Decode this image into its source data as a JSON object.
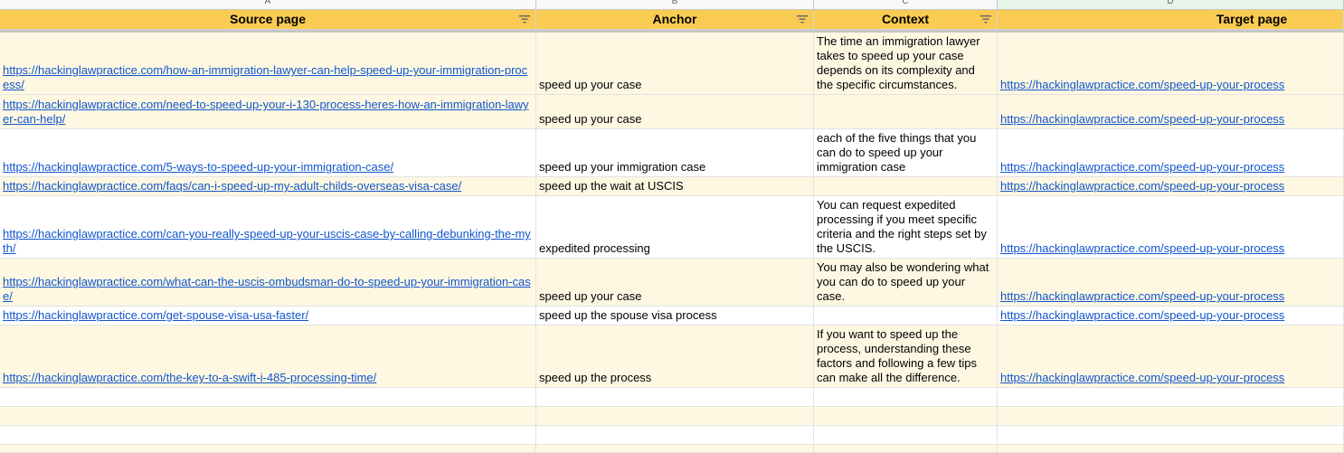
{
  "column_letters": [
    "A",
    "B",
    "C",
    "D"
  ],
  "headers": [
    "Source page",
    "Anchor",
    "Context",
    "Target page"
  ],
  "icons": {
    "filter": "filter-icon"
  },
  "colors": {
    "header_bg": "#f9cb52",
    "band_bg": "#fef8e3",
    "link": "#1155cc"
  },
  "rows": [
    {
      "source": "https://hackinglawpractice.com/how-an-immigration-lawyer-can-help-speed-up-your-immigration-process/",
      "anchor": "speed up your case",
      "context": "The time an immigration lawyer takes to speed up your case depends on its complexity and the specific circumstances.",
      "target": "https://hackinglawpractice.com/speed-up-your-process"
    },
    {
      "source": "https://hackinglawpractice.com/need-to-speed-up-your-i-130-process-heres-how-an-immigration-lawyer-can-help/",
      "anchor": "speed up your case",
      "context": "",
      "target": "https://hackinglawpractice.com/speed-up-your-process"
    },
    {
      "source": "https://hackinglawpractice.com/5-ways-to-speed-up-your-immigration-case/",
      "anchor": "speed up your immigration case",
      "context": "each of the five things that you can do to speed up your immigration case",
      "target": "https://hackinglawpractice.com/speed-up-your-process"
    },
    {
      "source": "https://hackinglawpractice.com/faqs/can-i-speed-up-my-adult-childs-overseas-visa-case/",
      "anchor": "speed up the wait at USCIS",
      "context": "",
      "target": "https://hackinglawpractice.com/speed-up-your-process"
    },
    {
      "source": "https://hackinglawpractice.com/can-you-really-speed-up-your-uscis-case-by-calling-debunking-the-myth/",
      "anchor": "expedited processing",
      "context": "You can request expedited processing if you meet specific criteria and the right steps set by the USCIS.",
      "target": "https://hackinglawpractice.com/speed-up-your-process"
    },
    {
      "source": "https://hackinglawpractice.com/what-can-the-uscis-ombudsman-do-to-speed-up-your-immigration-case/",
      "anchor": "speed up your case",
      "context": "You may also be wondering what you can do to speed up your case.",
      "target": "https://hackinglawpractice.com/speed-up-your-process"
    },
    {
      "source": "https://hackinglawpractice.com/get-spouse-visa-usa-faster/",
      "anchor": "speed up the spouse visa process",
      "context": "",
      "target": "https://hackinglawpractice.com/speed-up-your-process"
    },
    {
      "source": "https://hackinglawpractice.com/the-key-to-a-swift-i-485-processing-time/",
      "anchor": "speed up the process",
      "context": "If you want to speed up the process, understanding these factors and following a few tips can make all the difference.",
      "target": "https://hackinglawpractice.com/speed-up-your-process"
    },
    {
      "source": "",
      "anchor": "",
      "context": "",
      "target": ""
    },
    {
      "source": "",
      "anchor": "",
      "context": "",
      "target": ""
    },
    {
      "source": "",
      "anchor": "",
      "context": "",
      "target": ""
    },
    {
      "source": "",
      "anchor": "",
      "context": "",
      "target": ""
    }
  ]
}
